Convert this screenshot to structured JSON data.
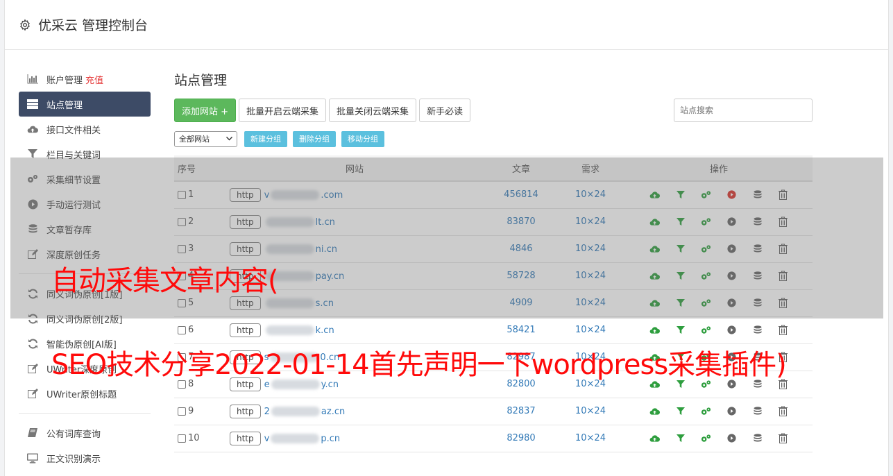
{
  "header": {
    "title": "优采云 管理控制台",
    "icon": "gear-icon"
  },
  "sidebar": {
    "group1": [
      {
        "label": "账户管理",
        "extra": "充值",
        "icon": "bar-chart-icon"
      },
      {
        "label": "站点管理",
        "icon": "server-icon",
        "active": true
      },
      {
        "label": "接口文件相关",
        "icon": "cloud-upload-icon"
      },
      {
        "label": "栏目与关键词",
        "icon": "filter-icon"
      },
      {
        "label": "采集细节设置",
        "icon": "gears-icon"
      },
      {
        "label": "手动运行测试",
        "icon": "play-circle-icon"
      },
      {
        "label": "文章暂存库",
        "icon": "database-icon"
      },
      {
        "label": "深度原创任务",
        "icon": "edit-icon"
      }
    ],
    "group2": [
      {
        "label": "同义词伪原创[1版]",
        "icon": "refresh-icon"
      },
      {
        "label": "同义词伪原创[2版]",
        "icon": "refresh-icon"
      },
      {
        "label": "智能伪原创[AI版]",
        "icon": "refresh-icon"
      },
      {
        "label": "UWriter深度原创",
        "icon": "edit-icon"
      },
      {
        "label": "UWriter原创标题",
        "icon": "edit-icon"
      }
    ],
    "group3": [
      {
        "label": "公有词库查询",
        "icon": "book-icon"
      },
      {
        "label": "正文识别演示",
        "icon": "monitor-icon"
      }
    ]
  },
  "main": {
    "title": "站点管理",
    "toolbar": {
      "add_site": "添加网站 +",
      "batch_open": "批量开启云端采集",
      "batch_close": "批量关闭云端采集",
      "newbie": "新手必读",
      "search_placeholder": "站点搜索"
    },
    "group_select": "全部网站",
    "group_buttons": {
      "new": "新建分组",
      "delete": "删除分组",
      "move": "移动分组"
    },
    "table": {
      "headers": [
        "序号",
        "网站",
        "文章",
        "需求",
        "操作"
      ],
      "rows": [
        {
          "idx": "1",
          "scheme": "http",
          "pre": "v",
          "suf": ".com",
          "articles": "456814",
          "req": "10×24",
          "running": true
        },
        {
          "idx": "2",
          "scheme": "http",
          "pre": "",
          "suf": "lt.cn",
          "articles": "83870",
          "req": "10×24",
          "running": false
        },
        {
          "idx": "3",
          "scheme": "http",
          "pre": "",
          "suf": "ni.cn",
          "articles": "4846",
          "req": "10×24",
          "running": false
        },
        {
          "idx": "4",
          "scheme": "http",
          "pre": "",
          "suf": "pay.cn",
          "articles": "58728",
          "req": "10×24",
          "running": false
        },
        {
          "idx": "5",
          "scheme": "http",
          "pre": "",
          "suf": "s.cn",
          "articles": "4909",
          "req": "10×24",
          "running": false
        },
        {
          "idx": "6",
          "scheme": "http",
          "pre": "",
          "suf": "k.cn",
          "articles": "58421",
          "req": "10×24",
          "running": false
        },
        {
          "idx": "7",
          "scheme": "http",
          "pre": "s",
          "suf": "0.cn",
          "articles": "82987",
          "req": "10×24",
          "running": false
        },
        {
          "idx": "8",
          "scheme": "http",
          "pre": "e",
          "suf": "y.cn",
          "articles": "82800",
          "req": "10×24",
          "running": false
        },
        {
          "idx": "9",
          "scheme": "http",
          "pre": "2",
          "suf": "az.cn",
          "articles": "82837",
          "req": "10×24",
          "running": false
        },
        {
          "idx": "10",
          "scheme": "http",
          "pre": "v",
          "suf": "p.cn",
          "articles": "82980",
          "req": "10×24",
          "running": false
        }
      ]
    }
  },
  "overlay": {
    "line1": "自动采集文章内容(",
    "line2": "SEO技术分享2022-01-14首先声明一下wordpress采集插件)"
  },
  "colors": {
    "green": "#5cb85c",
    "blue": "#337ab7",
    "red_text": "#ff0a0a",
    "active_nav": "#3d4b66"
  }
}
